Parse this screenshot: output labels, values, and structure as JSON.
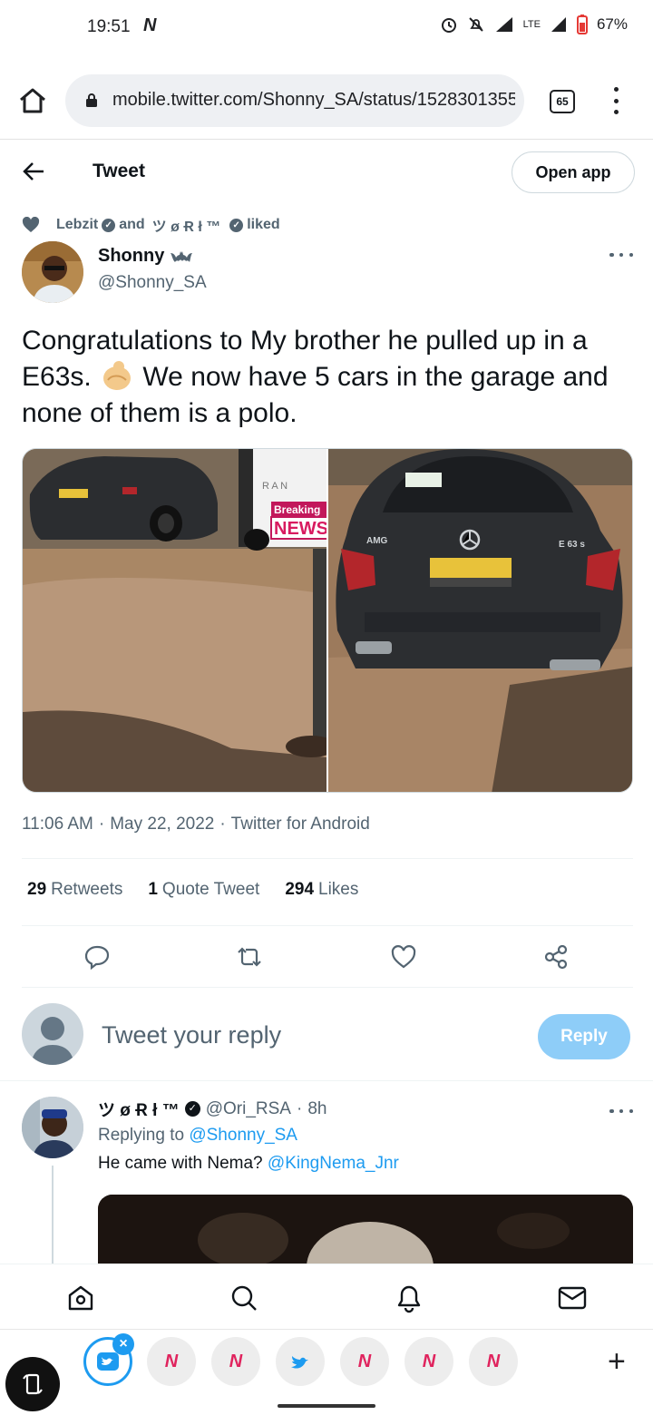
{
  "status_bar": {
    "time": "19:51",
    "carrier_logo": "N",
    "network": "LTE",
    "battery": "67%",
    "icons": [
      "alarm-icon",
      "mute-icon",
      "signal-icon",
      "battery-icon"
    ]
  },
  "browser": {
    "url": "mobile.twitter.com/Shonny_SA/status/1528301355",
    "tab_count": "65"
  },
  "header": {
    "title": "Tweet",
    "open_app_label": "Open app"
  },
  "social_context": {
    "user1": "Lebzit",
    "and": "and",
    "user2": "ツ ø Ɍ ł ™",
    "suffix": "liked"
  },
  "tweet": {
    "author_name": "Shonny",
    "author_handle": "@Shonny_SA",
    "text_before_emoji": "Congratulations to My brother he  pulled up in a E63s.",
    "text_after_emoji": "We now have 5 cars in the garage and none of them is a polo.",
    "photo1_sign_top": "Breaking",
    "photo1_sign_bottom": "NEWS",
    "photo1_vehicle_text": "R A N",
    "photo2_badge_amg": "AMG",
    "photo2_badge_model": "E 63 s",
    "time": "11:06 AM",
    "date": "May 22, 2022",
    "source": "Twitter for Android",
    "sep": "·",
    "retweets_count": "29",
    "retweets_label": "Retweets",
    "quotes_count": "1",
    "quotes_label": "Quote Tweet",
    "likes_count": "294",
    "likes_label": "Likes"
  },
  "composer": {
    "placeholder": "Tweet your reply",
    "reply_label": "Reply"
  },
  "reply": {
    "name": "ツ ø Ɍ ł ™",
    "handle": "@Ori_RSA",
    "age": "8h",
    "replying_prefix": "Replying to",
    "replying_to": "@Shonny_SA",
    "text": "He came with Nema?",
    "mention": "@KingNema_Jnr"
  },
  "dock": {
    "bubbles": [
      "twitter",
      "N",
      "N",
      "twitter",
      "N",
      "N",
      "N"
    ],
    "n_label": "N",
    "close_label": "×",
    "add_label": "+"
  },
  "colors": {
    "accent": "#1d9bf0",
    "reply_button": "#8ecdf8",
    "secondary_text": "#536471"
  }
}
